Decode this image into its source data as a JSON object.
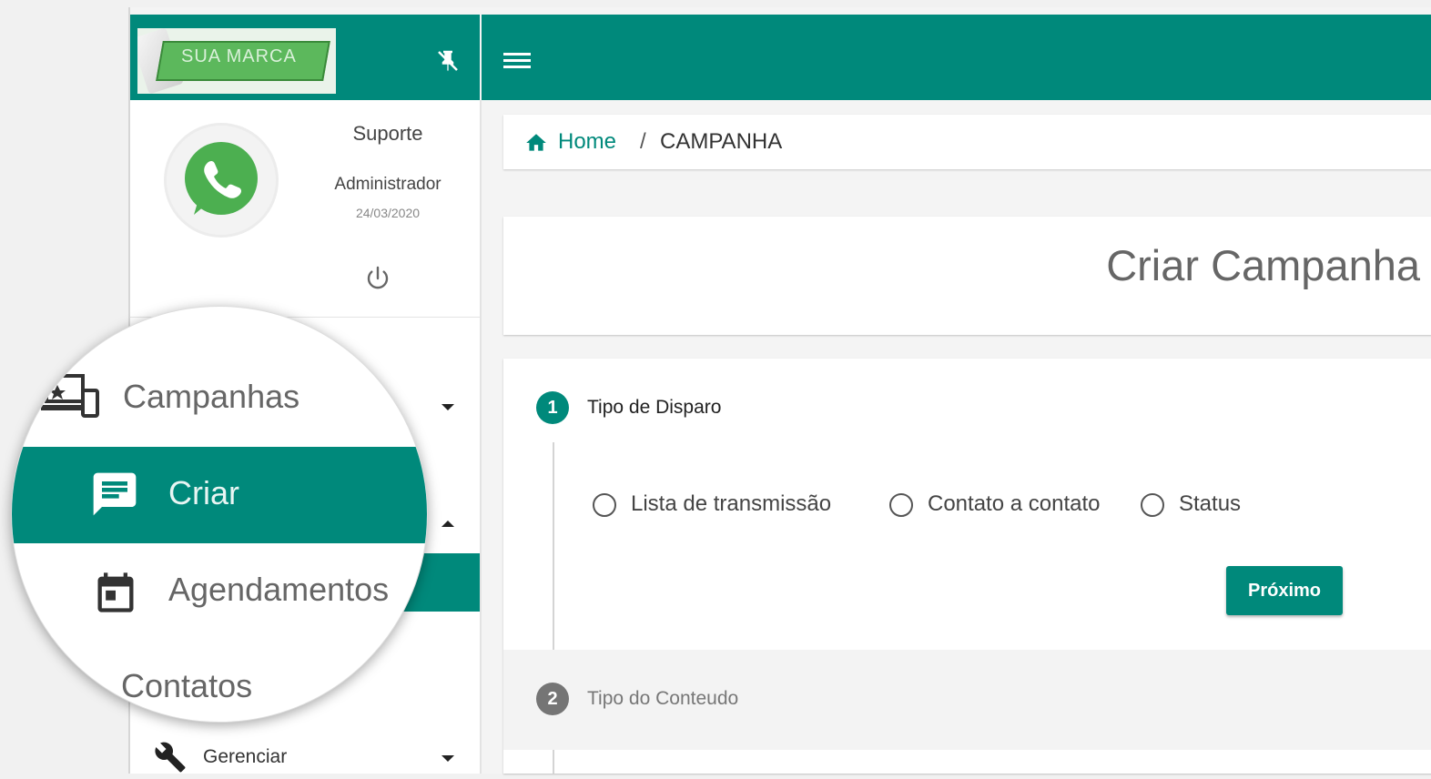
{
  "header": {
    "logo_text": "SUA MARCA",
    "brand_color": "#00897b",
    "menu_icon": "hamburger-menu-icon",
    "pin_icon": "pin-off-icon"
  },
  "profile": {
    "name": "Suporte",
    "role": "Administrador",
    "date": "24/03/2020",
    "avatar_icon": "whatsapp-icon",
    "logout_icon": "power-icon"
  },
  "sidebar": {
    "items": [
      {
        "label": "Campanhas",
        "icon": "campaign-devices-icon",
        "expanded": false
      },
      {
        "label": "Criar",
        "icon": "message-icon",
        "active": true
      },
      {
        "label": "Agendamentos",
        "icon": "calendar-icon"
      },
      {
        "label": "Contatos"
      },
      {
        "label": "Gerenciar",
        "icon": "wrench-icon",
        "expanded": false
      }
    ]
  },
  "breadcrumb": {
    "home": "Home",
    "separator": "/",
    "current": "CAMPANHA"
  },
  "page": {
    "title": "Criar Campanha"
  },
  "stepper": {
    "steps": [
      {
        "number": "1",
        "label": "Tipo de Disparo",
        "active": true
      },
      {
        "number": "2",
        "label": "Tipo do Conteudo",
        "active": false
      }
    ],
    "options": [
      "Lista de transmissão",
      "Contato a contato",
      "Status"
    ],
    "next_label": "Próximo"
  }
}
